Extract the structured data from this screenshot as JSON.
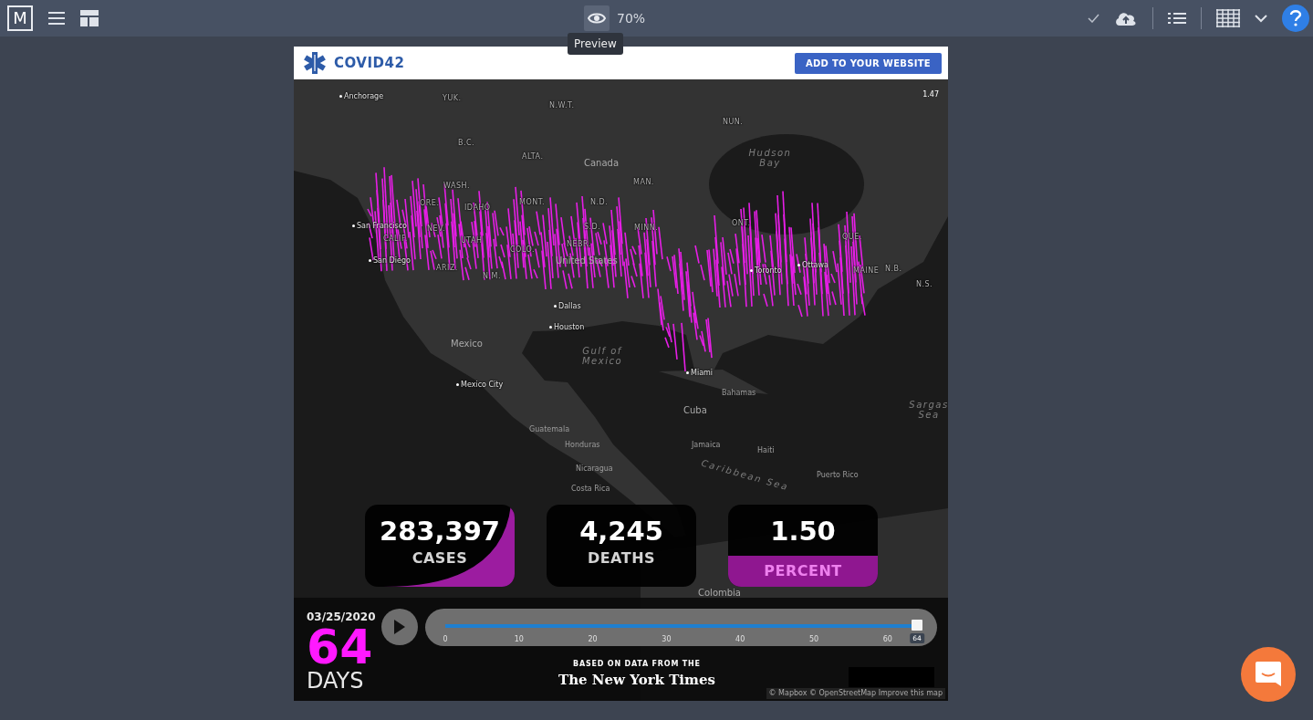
{
  "toolbar": {
    "logo": "M",
    "zoom": "70%",
    "tooltip": "Preview"
  },
  "header": {
    "title": "COVID42",
    "button": "ADD TO YOUR WEBSITE"
  },
  "map": {
    "scale": "1.47",
    "labels": [
      {
        "text": "Anchorage",
        "kind": "city"
      },
      {
        "text": "YUK.",
        "kind": "region"
      },
      {
        "text": "N.W.T.",
        "kind": "region"
      },
      {
        "text": "NUN.",
        "kind": "region"
      },
      {
        "text": "B.C.",
        "kind": "region"
      },
      {
        "text": "ALTA.",
        "kind": "region"
      },
      {
        "text": "Canada",
        "kind": "country"
      },
      {
        "text": "Hudson Bay",
        "kind": "water"
      },
      {
        "text": "MAN.",
        "kind": "region"
      },
      {
        "text": "WASH.",
        "kind": "region"
      },
      {
        "text": "ORE.",
        "kind": "region"
      },
      {
        "text": "IDAHO",
        "kind": "region"
      },
      {
        "text": "MONT.",
        "kind": "region"
      },
      {
        "text": "N.D.",
        "kind": "region"
      },
      {
        "text": "ONT.",
        "kind": "region"
      },
      {
        "text": "San Francisco",
        "kind": "city"
      },
      {
        "text": "NEV.",
        "kind": "region"
      },
      {
        "text": "CALIF.",
        "kind": "region"
      },
      {
        "text": "UTAH",
        "kind": "region"
      },
      {
        "text": "S.D.",
        "kind": "region"
      },
      {
        "text": "MINN.",
        "kind": "region"
      },
      {
        "text": "QUE.",
        "kind": "region"
      },
      {
        "text": "NEBR.",
        "kind": "region"
      },
      {
        "text": "COLO.",
        "kind": "region"
      },
      {
        "text": "San Diego",
        "kind": "city"
      },
      {
        "text": "United States",
        "kind": "country"
      },
      {
        "text": "ARIZ.",
        "kind": "region"
      },
      {
        "text": "N.M.",
        "kind": "region"
      },
      {
        "text": "Toronto",
        "kind": "city"
      },
      {
        "text": "Ottawa",
        "kind": "city"
      },
      {
        "text": "MAINE",
        "kind": "region"
      },
      {
        "text": "N.B.",
        "kind": "region"
      },
      {
        "text": "N.S.",
        "kind": "region"
      },
      {
        "text": "Dallas",
        "kind": "city"
      },
      {
        "text": "Houston",
        "kind": "city"
      },
      {
        "text": "Mexico",
        "kind": "country"
      },
      {
        "text": "Gulf of Mexico",
        "kind": "water"
      },
      {
        "text": "Miami",
        "kind": "city"
      },
      {
        "text": "Mexico City",
        "kind": "city"
      },
      {
        "text": "Bahamas",
        "kind": "place"
      },
      {
        "text": "Cuba",
        "kind": "country"
      },
      {
        "text": "Sargas Sea",
        "kind": "water"
      },
      {
        "text": "Guatemala",
        "kind": "place"
      },
      {
        "text": "Honduras",
        "kind": "place"
      },
      {
        "text": "Jamaica",
        "kind": "place"
      },
      {
        "text": "Haiti",
        "kind": "place"
      },
      {
        "text": "Nicaragua",
        "kind": "place"
      },
      {
        "text": "Caribbean Sea",
        "kind": "sea"
      },
      {
        "text": "Puerto Rico",
        "kind": "place"
      },
      {
        "text": "Costa Rica",
        "kind": "place"
      },
      {
        "text": "Colombia",
        "kind": "country"
      }
    ],
    "attribution": "© Mapbox © OpenStreetMap Improve this map"
  },
  "stats": [
    {
      "value": "283,397",
      "label": "CASES",
      "kind": "cases"
    },
    {
      "value": "4,245",
      "label": "DEATHS",
      "kind": "deaths"
    },
    {
      "value": "1.50",
      "label": "PERCENT",
      "kind": "percent"
    }
  ],
  "timeline": {
    "date": "03/25/2020",
    "days": "64",
    "unit": "DAYS",
    "level": 1,
    "ticks": [
      "0",
      "10",
      "20",
      "30",
      "40",
      "50",
      "60"
    ],
    "current": "64"
  },
  "source": {
    "caption": "BASED ON DATA FROM THE",
    "publisher": "The New York Times"
  }
}
